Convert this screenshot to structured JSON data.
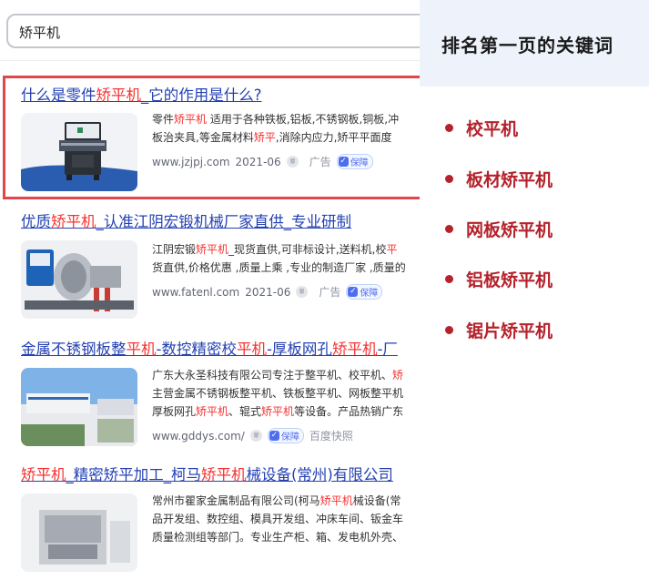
{
  "search": {
    "query": "矫平机"
  },
  "results": [
    {
      "title": [
        "什么是零件",
        "矫平机",
        "_它的作用是什么?"
      ],
      "desc1": [
        "零件",
        "矫平机",
        " 适用于各种铁板,铝板,不锈钢板,铜板,冲"
      ],
      "desc2": [
        "板治夹具,等金属材料",
        "矫平",
        ",消除内应力,矫平平面度"
      ],
      "domain": "www.jzjpj.com",
      "date": "2021-06",
      "ad": "广告",
      "badge": "保障"
    },
    {
      "title": [
        "优质",
        "矫平机",
        "_认准江阴宏锻机械厂家直供_专业研制"
      ],
      "desc1": [
        "江阴宏锻",
        "矫平机",
        "_现货直供,可非标设计,送料机,校",
        "平"
      ],
      "desc2": [
        "货直供,价格优惠 ,质量上乘 ,专业的制造厂家 ,质量的"
      ],
      "domain": "www.fatenl.com",
      "date": "2021-06",
      "ad": "广告",
      "badge": "保障"
    },
    {
      "title": [
        "金属不锈钢板整",
        "平机",
        "-数控精密校",
        "平机",
        "-厚板网孔",
        "矫平机",
        "-厂"
      ],
      "desc1": [
        "广东大永圣科技有限公司专注于整平机、校平机、",
        "矫"
      ],
      "desc2": [
        "主营金属不锈钢板整平机、铁板整平机、网板整平机"
      ],
      "desc3": [
        "厚板网孔",
        "矫平机",
        "、辊式",
        "矫平机",
        "等设备。产品热销广东"
      ],
      "domain": "www.gddys.com/",
      "badge": "保障",
      "kuaizhao": "百度快照"
    },
    {
      "title": [
        "矫平机",
        "_精密矫平加工_柯马",
        "矫平机",
        "械设备(常州)有限公司"
      ],
      "desc1": [
        "常州市瞿家金属制品有限公司(柯马",
        "矫平机",
        "械设备(常"
      ],
      "desc2": [
        "品开发组、数控组、模具开发组、冲床车间、钣金车"
      ],
      "desc3": [
        "质量检测组等部门。专业生产柜、箱、发电机外壳、"
      ]
    }
  ],
  "panel": {
    "title": "排名第一页的关键词",
    "keywords": [
      "校平机",
      "板材矫平机",
      "网板矫平机",
      "铝板矫平机",
      "锯片矫平机"
    ]
  },
  "colors": {
    "link": "#2440b3",
    "keyword_red": "#f73131",
    "highlight_border": "#e2454a",
    "panel_keyword": "#b5222b",
    "panel_bg": "#eef3fb"
  }
}
